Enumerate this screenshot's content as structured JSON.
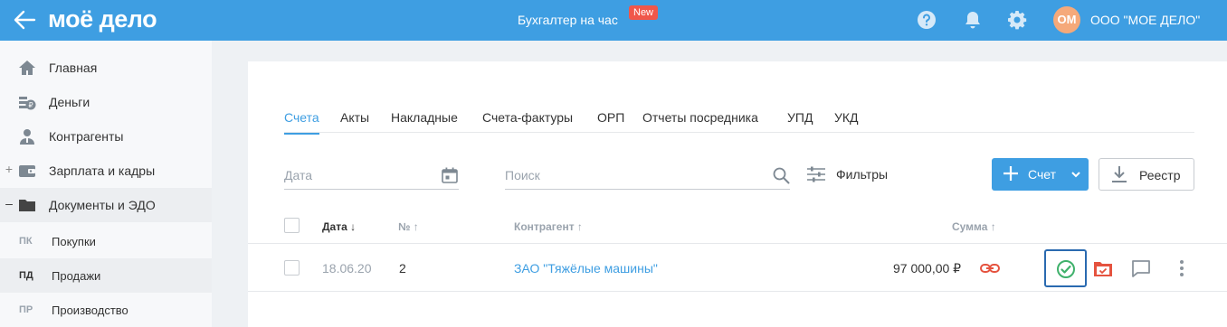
{
  "topbar": {
    "logo": "моё дело",
    "center_title": "Бухгалтер на час",
    "new_badge": "New",
    "avatar_initials": "ОМ",
    "org_name": "ООО \"МОЕ ДЕЛО\"",
    "icons": [
      "back-arrow-icon",
      "help-icon",
      "bell-icon",
      "gear-icon"
    ]
  },
  "sidebar": {
    "items": [
      {
        "label": "Главная",
        "icon": "home-icon"
      },
      {
        "label": "Деньги",
        "icon": "money-icon"
      },
      {
        "label": "Контрагенты",
        "icon": "contractor-icon"
      },
      {
        "label": "Зарплата и кадры",
        "icon": "wallet-icon",
        "prefix": "+"
      },
      {
        "label": "Документы и ЭДО",
        "icon": "folder-icon",
        "prefix": "–"
      }
    ],
    "subitems": [
      {
        "code": "ПК",
        "label": "Покупки"
      },
      {
        "code": "ПД",
        "label": "Продажи"
      },
      {
        "code": "ПР",
        "label": "Производство"
      }
    ]
  },
  "tabs": [
    "Счета",
    "Акты",
    "Накладные",
    "Счета-фактуры",
    "ОРП",
    "Отчеты посредника",
    "УПД",
    "УКД"
  ],
  "filters": {
    "date_placeholder": "Дата",
    "search_placeholder": "Поиск",
    "filters_label": "Фильтры",
    "new_invoice_label": "Счет",
    "registry_label": "Реестр"
  },
  "table": {
    "columns": {
      "date": "Дата ↓",
      "number": "№ ↑",
      "contractor": "Контрагент ↑",
      "sum": "Сумма ↑"
    },
    "rows": [
      {
        "date": "18.06.20",
        "number": "2",
        "contractor": "ЗАО \"Тяжёлые машины\"",
        "sum": "97 000,00 ₽"
      }
    ]
  },
  "colors": {
    "accent": "#3e9ee2",
    "success": "#3fb16b",
    "danger": "#e5533f"
  }
}
